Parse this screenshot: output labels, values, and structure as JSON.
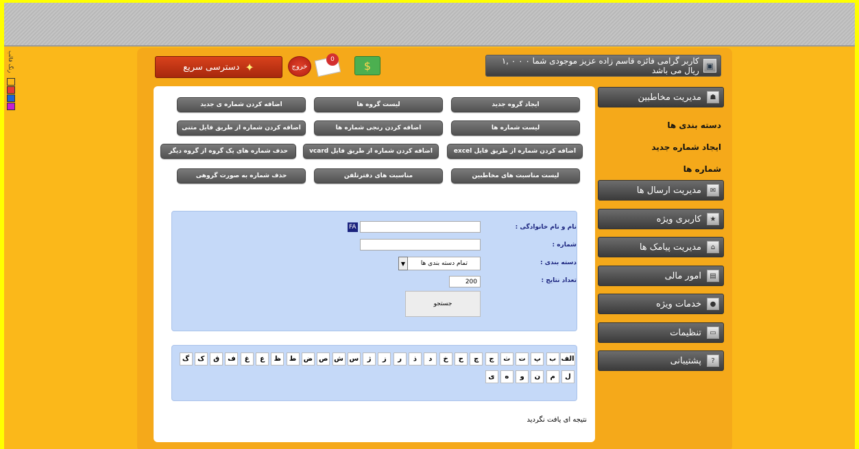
{
  "theme": {
    "label": "رنگ قالب",
    "swatches": [
      "#fbb81a",
      "#e53935",
      "#1e63d6",
      "#c51fd1"
    ]
  },
  "header": {
    "message": "کاربر گرامی فائزه قاسم زاده عزیز موجودی شما ۰ ۰ ۰ ,۱ ریال می باشد",
    "mail_count": "0",
    "logout_label": "خروج",
    "quick_access_label": "دسترسی سریع"
  },
  "actions": [
    [
      "ایجاد گروه جدید",
      "لیست گروه ها",
      "اضافه کردن شماره ی جدید"
    ],
    [
      "لیست شماره ها",
      "اضافه کردن رنجی شماره ها",
      "اضافه کردن شماره از طریق فایل متنی"
    ],
    [
      "اضافه کردن شماره از طریق فایل excel",
      "اضافه کردن شماره از طریق فایل vcard",
      "حذف شماره های یک گروه از گروه دیگر"
    ],
    [
      "لیست مناسبت های مخاطبین",
      "مناسبت های دفترتلفن",
      "حذف شماره به صورت گروهی"
    ]
  ],
  "search_form": {
    "name_label": "نام و نام خانوادگی :",
    "name_value": "",
    "fa_badge": "FA",
    "number_label": "شماره :",
    "number_value": "",
    "category_label": "دسته بندی :",
    "category_value": "تمام دسته بندی ها",
    "results_label": "تعداد نتایج :",
    "results_value": "200",
    "search_button": "جستجو"
  },
  "alphabet_row1": [
    "الف",
    "ب",
    "پ",
    "ت",
    "ث",
    "ج",
    "چ",
    "ح",
    "خ",
    "د",
    "ذ",
    "ر",
    "ز",
    "ژ",
    "س",
    "ش",
    "ص",
    "ض",
    "ط",
    "ظ",
    "ع",
    "غ",
    "ف",
    "ق",
    "ک",
    "گ"
  ],
  "alphabet_row2": [
    "ل",
    "م",
    "ن",
    "و",
    "ه",
    "ی"
  ],
  "no_result_text": "نتیجه ای یافت نگردید",
  "sidebar": {
    "contacts": "مدیریت مخاطبین",
    "sub": [
      "دسته بندی ها",
      "ایجاد شماره جدید",
      "شماره ها"
    ],
    "items": [
      "مدیریت ارسال ها",
      "کاربری ویژه",
      "مدیریت پیامک ها",
      "امور مالی",
      "خدمات ویژه",
      "تنظیمات",
      "پشتیبانی"
    ]
  }
}
